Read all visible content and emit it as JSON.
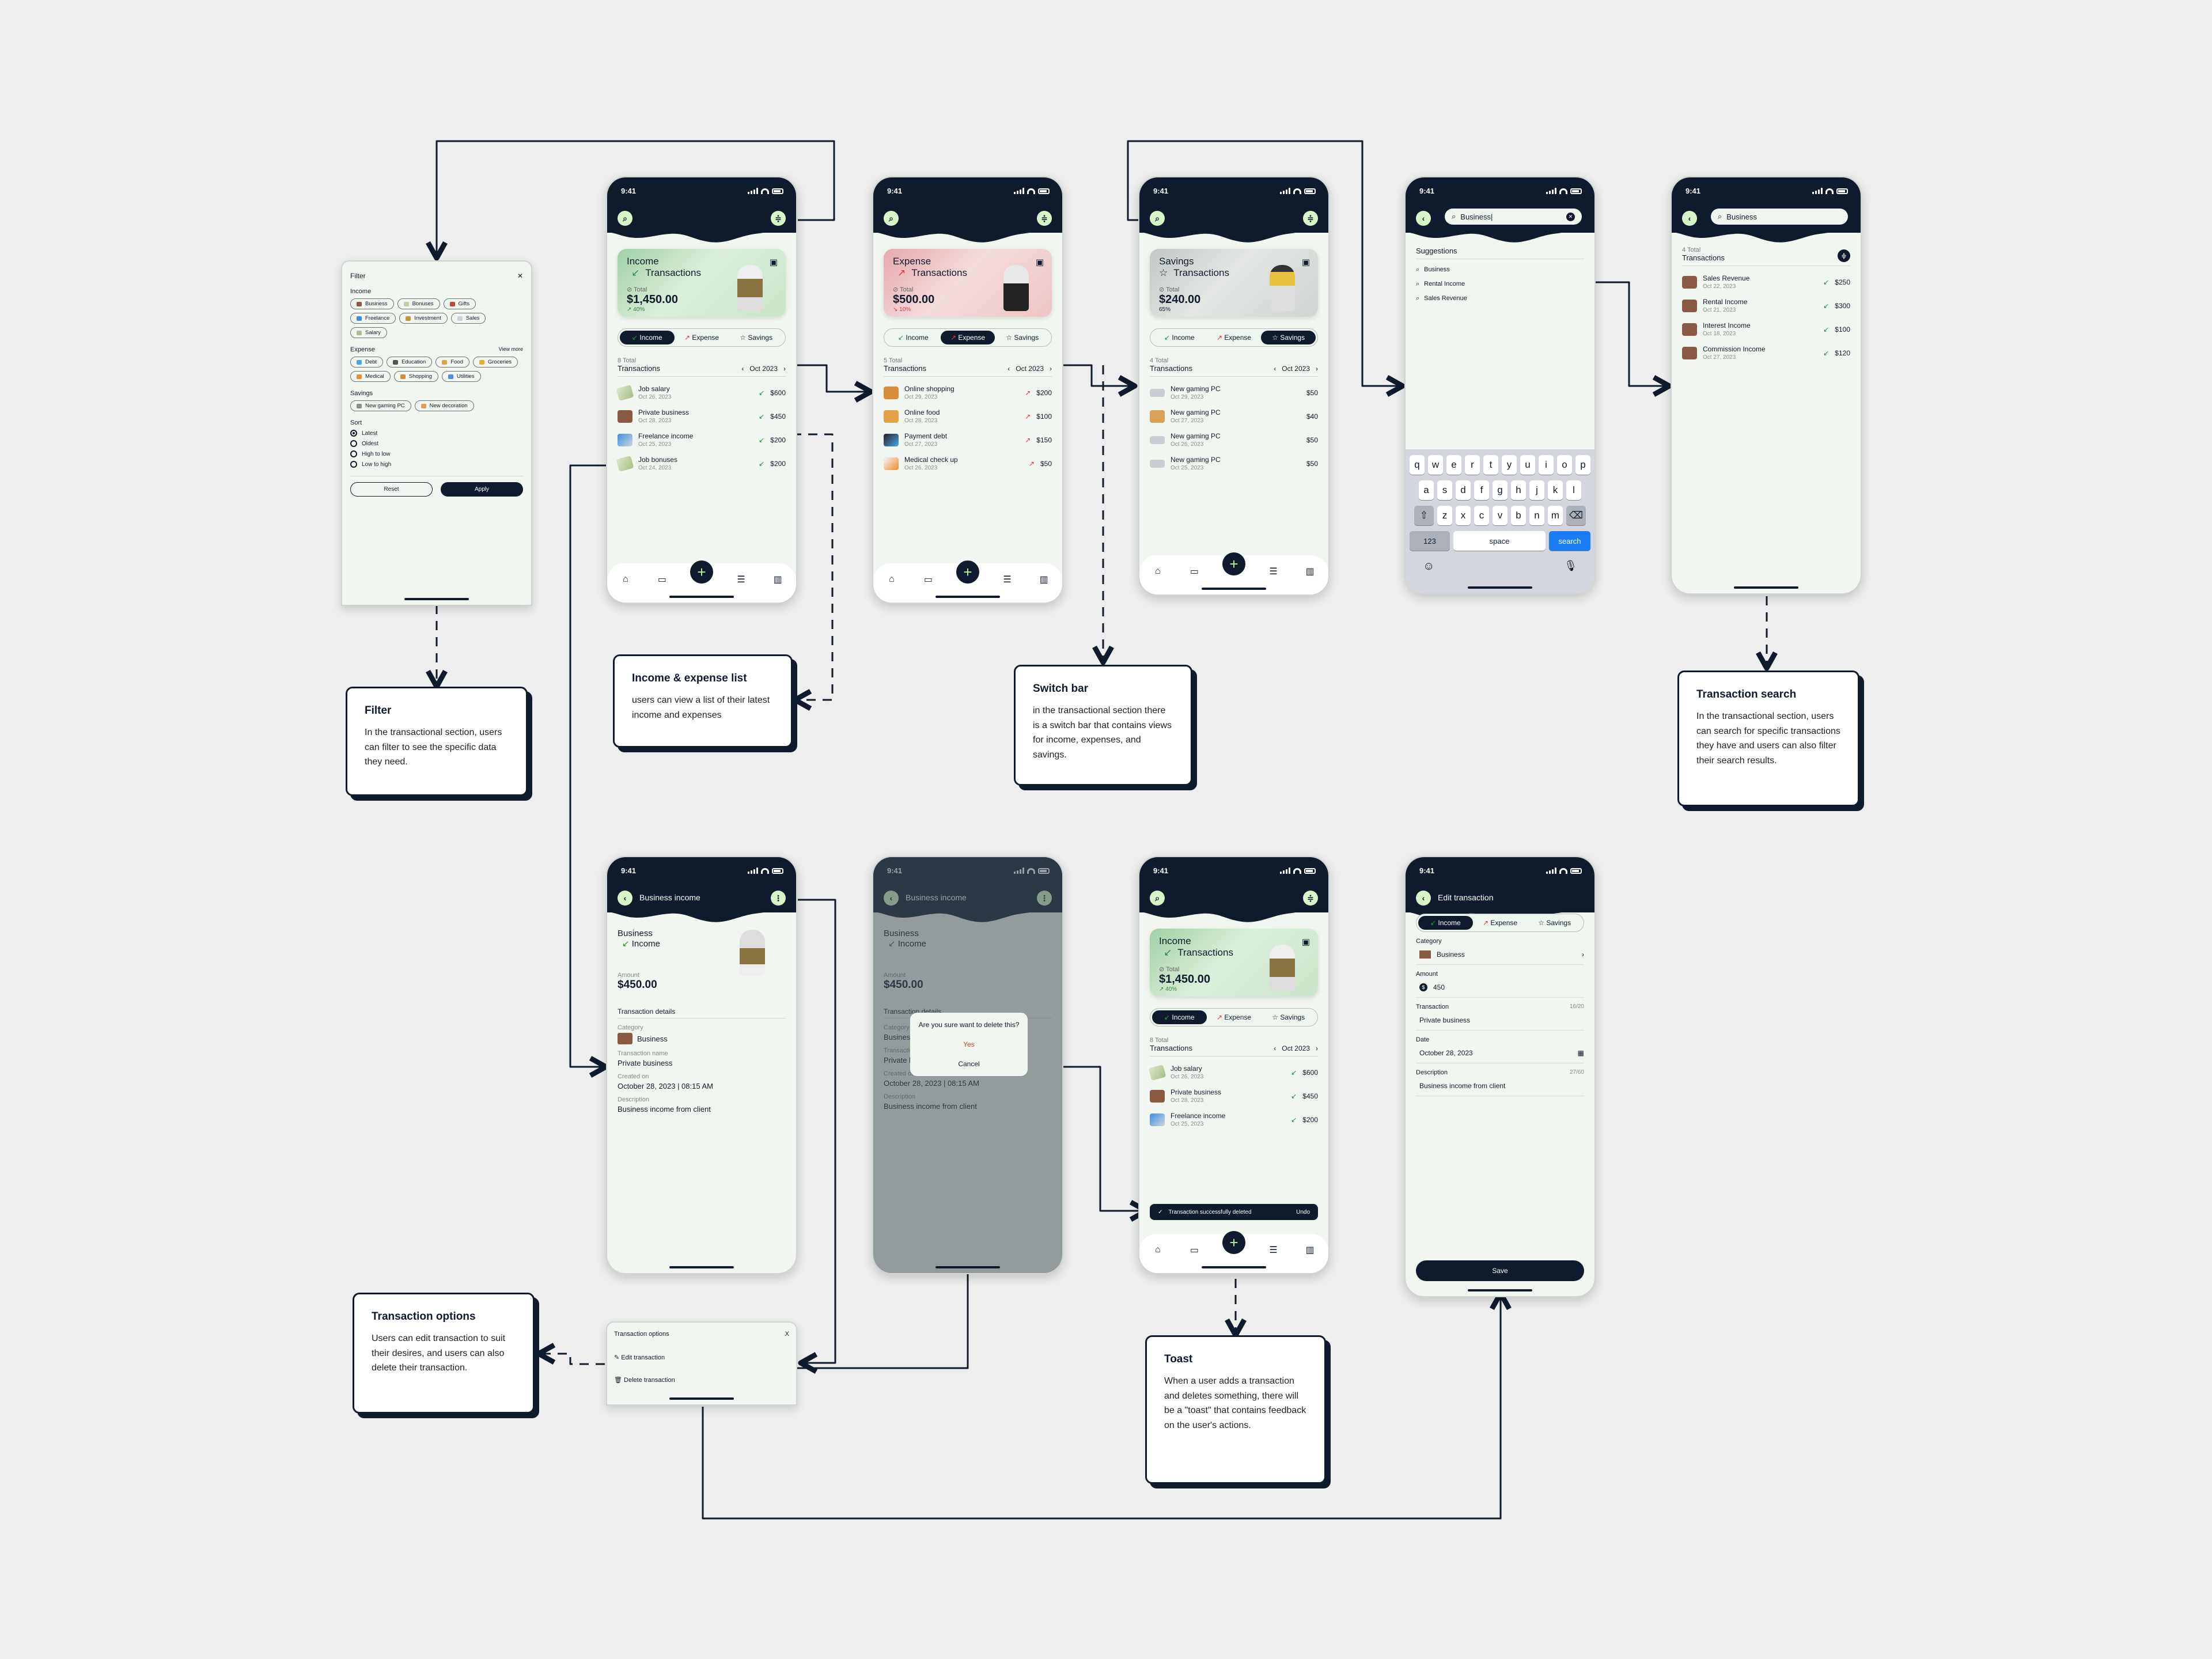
{
  "status": {
    "time": "9:41"
  },
  "filter": {
    "title": "Filter",
    "close": "✕",
    "income_label": "Income",
    "income_chips": [
      {
        "label": "Business",
        "color": "#8b5a44"
      },
      {
        "label": "Bonuses",
        "color": "#b8d3a5"
      },
      {
        "label": "Gifts",
        "color": "#c4423f"
      },
      {
        "label": "Freelance",
        "color": "#3d8de0"
      },
      {
        "label": "Investment",
        "color": "#c9923c"
      },
      {
        "label": "Sales",
        "color": "#c9d2dc"
      },
      {
        "label": "Salary",
        "color": "#a6c38e"
      }
    ],
    "expense_label": "Expense",
    "view_more": "View more",
    "expense_chips": [
      {
        "label": "Debt",
        "color": "#49a6ea"
      },
      {
        "label": "Education",
        "color": "#555555"
      },
      {
        "label": "Food",
        "color": "#e2a348"
      },
      {
        "label": "Groceries",
        "color": "#e2b03a"
      },
      {
        "label": "Medical",
        "color": "#ef8b2c"
      },
      {
        "label": "Shopping",
        "color": "#d98a3a"
      },
      {
        "label": "Utilities",
        "color": "#4a90e2"
      }
    ],
    "savings_label": "Savings",
    "savings_chips": [
      {
        "label": "New gaming PC",
        "color": "#8a8f93"
      },
      {
        "label": "New decoration",
        "color": "#d8a25a"
      }
    ],
    "sort_label": "Sort",
    "sort_options": [
      {
        "label": "Latest",
        "selected": true
      },
      {
        "label": "Oldest",
        "selected": false
      },
      {
        "label": "High to low",
        "selected": false
      },
      {
        "label": "Low to high",
        "selected": false
      }
    ],
    "reset": "Reset",
    "apply": "Apply"
  },
  "switch": {
    "income": "Income",
    "expense": "Expense",
    "savings": "Savings"
  },
  "month": "Oct 2023",
  "list_title": "Transactions",
  "total_label": "Total",
  "income_screen": {
    "line1": "Income",
    "line2": "Transactions",
    "total": "$1,450.00",
    "change": "40%",
    "count": "8 Total",
    "rows": [
      {
        "name": "Job salary",
        "date": "Oct 26, 2023",
        "amount": "$600",
        "icon": "cash"
      },
      {
        "name": "Private business",
        "date": "Oct 28, 2023",
        "amount": "$450",
        "icon": "bag"
      },
      {
        "name": "Freelance income",
        "date": "Oct 25, 2023",
        "amount": "$200",
        "icon": "card"
      },
      {
        "name": "Job bonuses",
        "date": "Oct 24, 2023",
        "amount": "$200",
        "icon": "cash"
      }
    ]
  },
  "expense_screen": {
    "line1": "Expense",
    "line2": "Transactions",
    "total": "$500.00",
    "change": "10%",
    "count": "5 Total",
    "rows": [
      {
        "name": "Online shopping",
        "date": "Oct 29, 2023",
        "amount": "$200",
        "icon": "shop"
      },
      {
        "name": "Online food",
        "date": "Oct 28, 2023",
        "amount": "$100",
        "icon": "food"
      },
      {
        "name": "Payment debt",
        "date": "Oct 27, 2023",
        "amount": "$150",
        "icon": "debt"
      },
      {
        "name": "Medical check up",
        "date": "Oct 26, 2023",
        "amount": "$50",
        "icon": "med"
      }
    ]
  },
  "savings_screen": {
    "line1": "Savings",
    "line2": "Transactions",
    "total": "$240.00",
    "change": "65%",
    "count": "4 Total",
    "rows": [
      {
        "name": "New gaming PC",
        "date": "Oct 29, 2023",
        "amount": "$50",
        "icon": "laptop"
      },
      {
        "name": "New gaming PC",
        "date": "Oct 27, 2023",
        "amount": "$40",
        "icon": "chair"
      },
      {
        "name": "New gaming PC",
        "date": "Oct 26, 2023",
        "amount": "$50",
        "icon": "laptop"
      },
      {
        "name": "New gaming PC",
        "date": "Oct 25, 2023",
        "amount": "$50",
        "icon": "laptop"
      }
    ]
  },
  "search_screen": {
    "query": "Business|",
    "suggestions_title": "Suggestions",
    "suggestions": [
      "Business",
      "Rental Income",
      "Sales Revenue"
    ],
    "keyboard": {
      "row1": [
        "q",
        "w",
        "e",
        "r",
        "t",
        "y",
        "u",
        "i",
        "o",
        "p"
      ],
      "row2": [
        "a",
        "s",
        "d",
        "f",
        "g",
        "h",
        "j",
        "k",
        "l"
      ],
      "row3": [
        "z",
        "x",
        "c",
        "v",
        "b",
        "n",
        "m"
      ],
      "num": "123",
      "space": "space",
      "search": "search"
    }
  },
  "results_screen": {
    "query": "Business",
    "count": "4 Total",
    "rows": [
      {
        "name": "Sales Revenue",
        "date": "Oct 22, 2023",
        "amount": "$250"
      },
      {
        "name": "Rental Income",
        "date": "Oct 21, 2023",
        "amount": "$300"
      },
      {
        "name": "Interest Income",
        "date": "Oct 18, 2023",
        "amount": "$100"
      },
      {
        "name": "Commission Income",
        "date": "Oct 27, 2023",
        "amount": "$120"
      }
    ]
  },
  "detail_screen": {
    "title": "Business income",
    "heading1": "Business",
    "heading2": "Income",
    "amount_label": "Amount",
    "amount": "$450.00",
    "section": "Transaction details",
    "category_label": "Category",
    "category": "Business",
    "name_label": "Transaction name",
    "name": "Private business",
    "created_label": "Created on",
    "created": "October 28, 2023 | 08:15 AM",
    "desc_label": "Description",
    "desc": "Business income from client"
  },
  "delete_dialog": {
    "question": "Are you sure want to delete this?",
    "yes": "Yes",
    "cancel": "Cancel"
  },
  "toast": {
    "message": "Transaction successfully deleted",
    "undo": "Undo"
  },
  "toast_screen_rows": [
    {
      "name": "Job salary",
      "date": "Oct 26, 2023",
      "amount": "$600",
      "icon": "cash"
    },
    {
      "name": "Private business",
      "date": "Oct 28, 2023",
      "amount": "$450",
      "icon": "bag"
    },
    {
      "name": "Freelance income",
      "date": "Oct 25, 2023",
      "amount": "$200",
      "icon": "card"
    }
  ],
  "edit_screen": {
    "title": "Edit transaction",
    "category_label": "Category",
    "category": "Business",
    "amount_label": "Amount",
    "amount": "450",
    "transaction_label": "Transaction",
    "transaction_count": "16/20",
    "transaction": "Private business",
    "date_label": "Date",
    "date": "October 28, 2023",
    "desc_label": "Description",
    "desc_count": "27/60",
    "desc": "Business income from client",
    "save": "Save"
  },
  "options_sheet": {
    "title": "Transaction options",
    "edit": "Edit transaction",
    "delete": "Delete transaction",
    "close": "X"
  },
  "notes": {
    "filter": {
      "title": "Filter",
      "body": "In the transactional section, users can filter to see the specific data they need."
    },
    "list": {
      "title": "Income & expense list",
      "body": "users can view a list of their latest income and expenses"
    },
    "switch": {
      "title": "Switch bar",
      "body": "in the transactional section there is a switch bar that contains views for income, expenses, and savings."
    },
    "search": {
      "title": "Transaction search",
      "body": "In the transactional section, users can search for specific transactions they have and users can also filter their search results."
    },
    "options": {
      "title": "Transaction options",
      "body": "Users can edit transaction to suit their desires, and users can also delete their transaction."
    },
    "toast": {
      "title": "Toast",
      "body": "When a user adds a transaction and deletes something, there will be a \"toast\" that contains feedback on the user's actions."
    }
  },
  "colors": {
    "navy": "#0f1b2c",
    "mint": "#d8f5c7",
    "income_green": "#2e8b3a",
    "expense_red": "#d93b3b",
    "keyboard_blue": "#1a7cf2"
  }
}
